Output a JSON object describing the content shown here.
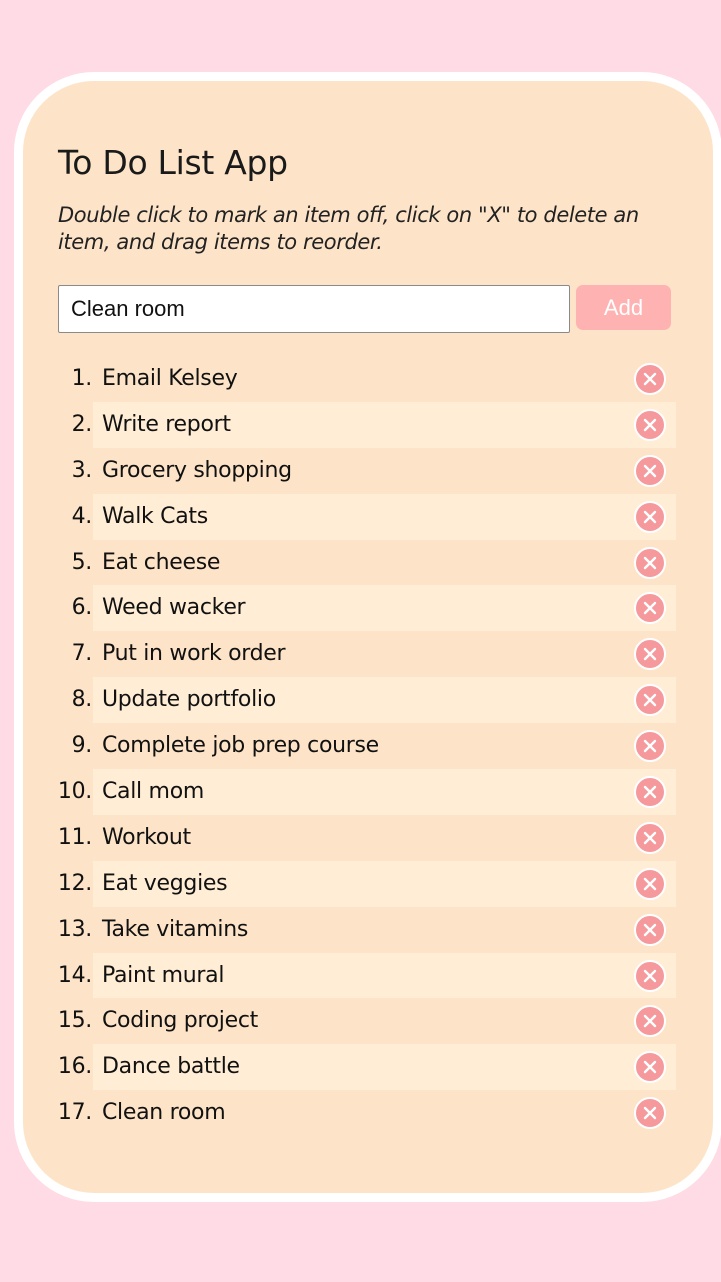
{
  "app": {
    "title": "To Do List App",
    "instructions": "Double click to mark an item off, click on \"X\" to delete an item, and drag items to reorder."
  },
  "form": {
    "input_value": "Clean room",
    "add_label": "Add"
  },
  "colors": {
    "page_background": "#ffdbe5",
    "card_background": "#fde4c8",
    "stripe_background": "#ffedd5",
    "add_button": "#ffb2b2",
    "delete_button": "#f5999d"
  },
  "todos": [
    {
      "number": "1.",
      "text": "Email Kelsey"
    },
    {
      "number": "2.",
      "text": "Write report"
    },
    {
      "number": "3.",
      "text": "Grocery shopping"
    },
    {
      "number": "4.",
      "text": "Walk Cats"
    },
    {
      "number": "5.",
      "text": "Eat cheese"
    },
    {
      "number": "6.",
      "text": "Weed wacker"
    },
    {
      "number": "7.",
      "text": "Put in work order"
    },
    {
      "number": "8.",
      "text": "Update portfolio"
    },
    {
      "number": "9.",
      "text": "Complete job prep course"
    },
    {
      "number": "10.",
      "text": "Call mom"
    },
    {
      "number": "11.",
      "text": "Workout"
    },
    {
      "number": "12.",
      "text": "Eat veggies"
    },
    {
      "number": "13.",
      "text": "Take vitamins"
    },
    {
      "number": "14.",
      "text": "Paint mural"
    },
    {
      "number": "15.",
      "text": "Coding project"
    },
    {
      "number": "16.",
      "text": "Dance battle"
    },
    {
      "number": "17.",
      "text": "Clean room"
    }
  ]
}
